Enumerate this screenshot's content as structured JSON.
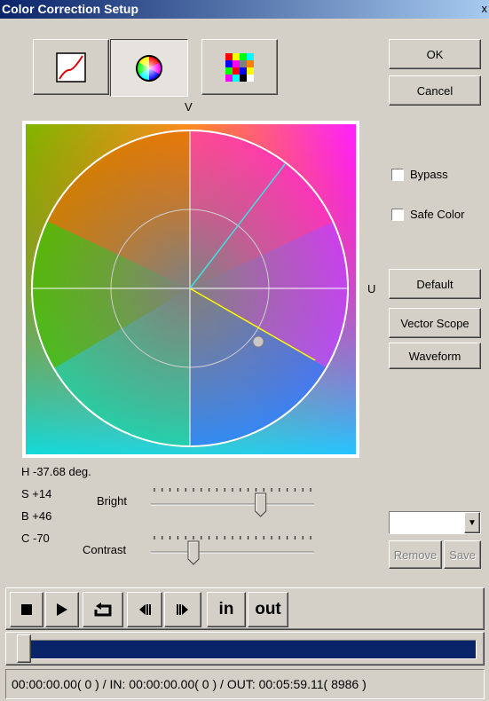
{
  "window": {
    "title": "Color Correction Setup",
    "close_glyph": "x"
  },
  "mode_buttons": [
    {
      "icon": "curve-icon"
    },
    {
      "icon": "color-wheel-icon",
      "pressed": true
    },
    {
      "icon": "color-bars-icon"
    }
  ],
  "buttons": {
    "ok": "OK",
    "cancel": "Cancel",
    "default": "Default",
    "vector_scope": "Vector Scope",
    "waveform": "Waveform",
    "remove": "Remove",
    "save": "Save"
  },
  "checkboxes": {
    "bypass": {
      "label": "Bypass",
      "checked": false
    },
    "safe_color": {
      "label": "Safe Color",
      "checked": false
    }
  },
  "axis_labels": {
    "v": "V",
    "u": "U"
  },
  "readouts": {
    "h": "H  -37.68 deg.",
    "s": "S  +14",
    "b": "B  +46",
    "c": "C  -70"
  },
  "sliders": {
    "bright": {
      "label": "Bright",
      "value": 0.68
    },
    "contrast": {
      "label": "Contrast",
      "value": 0.25
    }
  },
  "preset_dropdown": {
    "value": ""
  },
  "transport": {
    "in_label": "in",
    "out_label": "out"
  },
  "timeline": {
    "position": 0.0
  },
  "status": {
    "text": "00:00:00.00( 0 ) / IN: 00:00:00.00( 0 ) / OUT: 00:05:59.11( 8986 )"
  },
  "colors": {
    "title_bar": "#0a246a",
    "timeline_bar": "#0a246a",
    "dialog_bg": "#d4d0c8"
  }
}
